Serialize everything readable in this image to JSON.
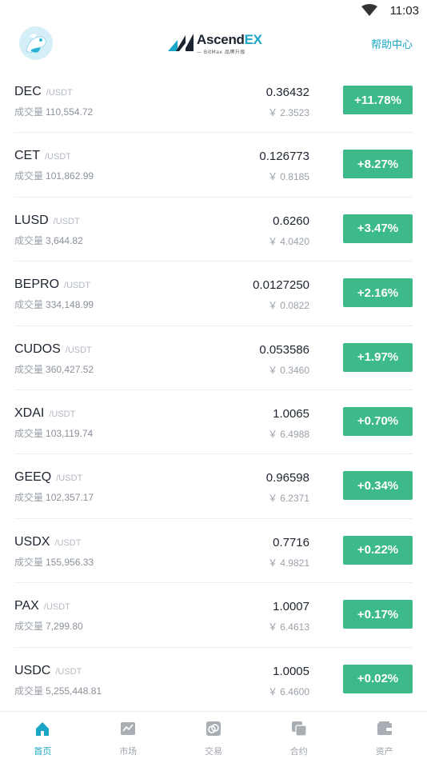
{
  "status": {
    "time": "11:03"
  },
  "header": {
    "logo_text_main": "Ascend",
    "logo_text_ex": "EX",
    "logo_sub": "— BitMax 品牌升级",
    "help_label": "帮助中心"
  },
  "colors": {
    "accent": "#1aa7c7",
    "positive": "#3dba8a"
  },
  "labels": {
    "volume": "成交量"
  },
  "rows": [
    {
      "symbol": "DEC",
      "quote": "/USDT",
      "volume": "110,554.72",
      "price": "0.36432",
      "cny": "￥ 2.3523",
      "change": "+11.78%"
    },
    {
      "symbol": "CET",
      "quote": "/USDT",
      "volume": "101,862.99",
      "price": "0.126773",
      "cny": "￥ 0.8185",
      "change": "+8.27%"
    },
    {
      "symbol": "LUSD",
      "quote": "/USDT",
      "volume": "3,644.82",
      "price": "0.6260",
      "cny": "￥ 4.0420",
      "change": "+3.47%"
    },
    {
      "symbol": "BEPRO",
      "quote": "/USDT",
      "volume": "334,148.99",
      "price": "0.0127250",
      "cny": "￥ 0.0822",
      "change": "+2.16%"
    },
    {
      "symbol": "CUDOS",
      "quote": "/USDT",
      "volume": "360,427.52",
      "price": "0.053586",
      "cny": "￥ 0.3460",
      "change": "+1.97%"
    },
    {
      "symbol": "XDAI",
      "quote": "/USDT",
      "volume": "103,119.74",
      "price": "1.0065",
      "cny": "￥ 6.4988",
      "change": "+0.70%"
    },
    {
      "symbol": "GEEQ",
      "quote": "/USDT",
      "volume": "102,357.17",
      "price": "0.96598",
      "cny": "￥ 6.2371",
      "change": "+0.34%"
    },
    {
      "symbol": "USDX",
      "quote": "/USDT",
      "volume": "155,956.33",
      "price": "0.7716",
      "cny": "￥ 4.9821",
      "change": "+0.22%"
    },
    {
      "symbol": "PAX",
      "quote": "/USDT",
      "volume": "7,299.80",
      "price": "1.0007",
      "cny": "￥ 6.4613",
      "change": "+0.17%"
    },
    {
      "symbol": "USDC",
      "quote": "/USDT",
      "volume": "5,255,448.81",
      "price": "1.0005",
      "cny": "￥ 6.4600",
      "change": "+0.02%"
    }
  ],
  "tabs": [
    {
      "label": "首页",
      "icon": "home-icon",
      "active": true
    },
    {
      "label": "市场",
      "icon": "chart-icon",
      "active": false
    },
    {
      "label": "交易",
      "icon": "exchange-icon",
      "active": false
    },
    {
      "label": "合约",
      "icon": "contract-icon",
      "active": false
    },
    {
      "label": "资产",
      "icon": "wallet-icon",
      "active": false
    }
  ]
}
